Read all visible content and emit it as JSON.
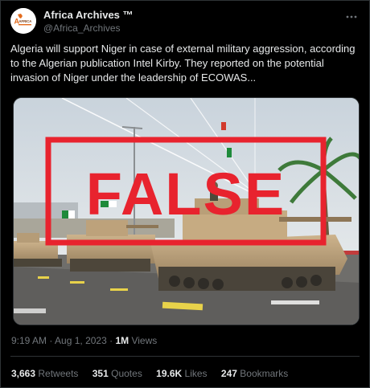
{
  "author": {
    "name": "Africa Archives ™",
    "handle": "@Africa_Archives",
    "avatar_logo_text": "AFRICA"
  },
  "more_icon": "more-horizontal-icon",
  "tweet": {
    "text": "Algeria will support Niger in case of external military aggression, according to the Algerian publication Intel Kirby. They reported on the potential invasion of Niger under the leadership of ECOWAS..."
  },
  "media": {
    "stamp_text": "FALSE",
    "stamp_color": "#e8232e"
  },
  "meta": {
    "time": "9:19 AM",
    "separator": " · ",
    "date": "Aug 1, 2023",
    "views_count": "1M",
    "views_label": " Views"
  },
  "stats": [
    {
      "count": "3,663",
      "label": "Retweets"
    },
    {
      "count": "351",
      "label": "Quotes"
    },
    {
      "count": "19.6K",
      "label": "Likes"
    },
    {
      "count": "247",
      "label": "Bookmarks"
    }
  ],
  "colors": {
    "background": "#000000",
    "text": "#e7e9ea",
    "secondary": "#71767b",
    "border": "#2f3336"
  }
}
